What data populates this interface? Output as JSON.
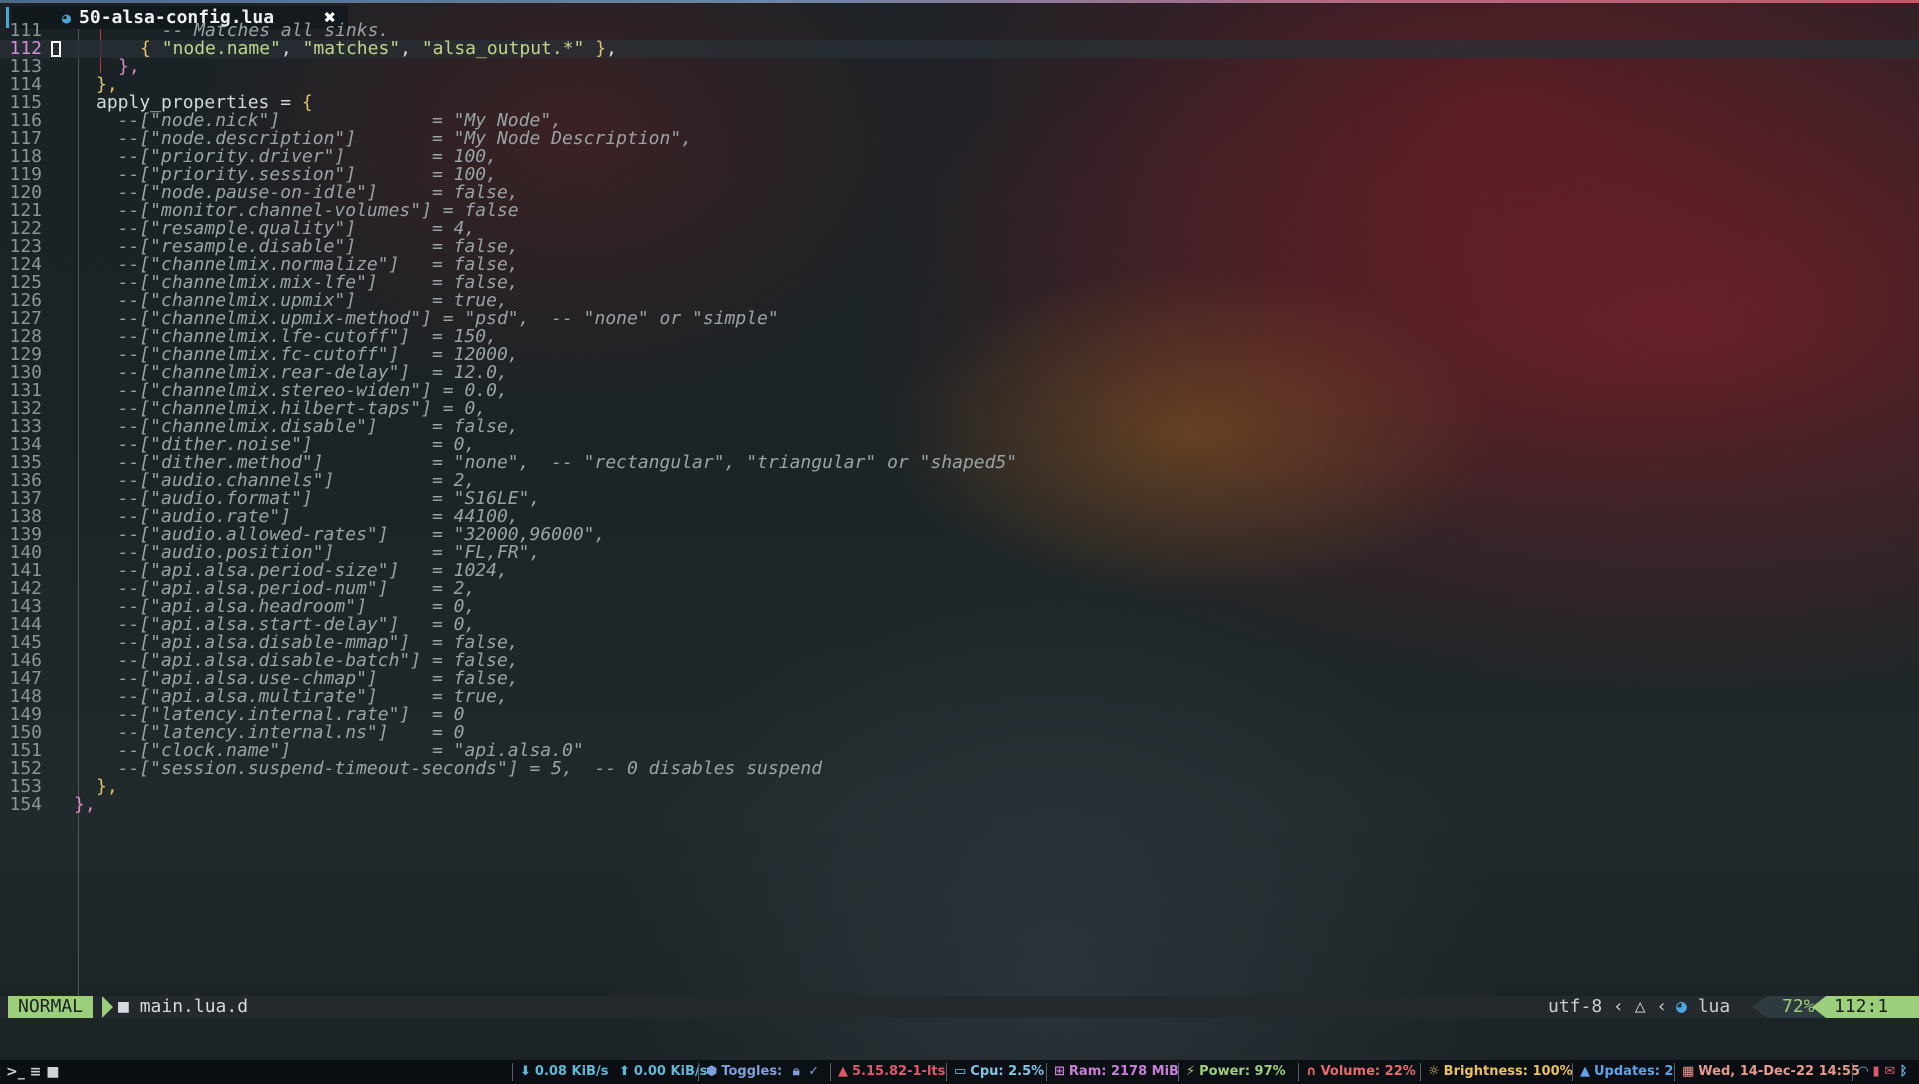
{
  "tab": {
    "filename": "50-alsa-config.lua",
    "icon": "lua-file-icon",
    "close_glyph": "✖"
  },
  "editor": {
    "lines": [
      {
        "n": "111",
        "segs": [
          [
            "com",
            "  -- Matches all sinks."
          ]
        ]
      },
      {
        "n": "112",
        "segs": [
          [
            "br",
            "{ "
          ],
          [
            "str",
            "\"node.name\""
          ],
          [
            "txt",
            ", "
          ],
          [
            "str",
            "\"matches\""
          ],
          [
            "txt",
            ", "
          ],
          [
            "str",
            "\"alsa_output.*\""
          ],
          [
            "br",
            " }"
          ],
          [
            "txt",
            ","
          ]
        ]
      },
      {
        "n": "113",
        "segs": [
          [
            "br2",
            "},"
          ]
        ]
      },
      {
        "n": "114",
        "segs": [
          [
            "br",
            "},"
          ]
        ]
      },
      {
        "n": "115",
        "segs": [
          [
            "txt",
            "apply_properties = "
          ],
          [
            "br",
            "{"
          ]
        ]
      },
      {
        "n": "116",
        "segs": [
          [
            "com",
            "  --[\"node.nick\"]              = \"My Node\","
          ]
        ]
      },
      {
        "n": "117",
        "segs": [
          [
            "com",
            "  --[\"node.description\"]       = \"My Node Description\","
          ]
        ]
      },
      {
        "n": "118",
        "segs": [
          [
            "com",
            "  --[\"priority.driver\"]        = 100,"
          ]
        ]
      },
      {
        "n": "119",
        "segs": [
          [
            "com",
            "  --[\"priority.session\"]       = 100,"
          ]
        ]
      },
      {
        "n": "120",
        "segs": [
          [
            "com",
            "  --[\"node.pause-on-idle\"]     = false,"
          ]
        ]
      },
      {
        "n": "121",
        "segs": [
          [
            "com",
            "  --[\"monitor.channel-volumes\"] = false"
          ]
        ]
      },
      {
        "n": "122",
        "segs": [
          [
            "com",
            "  --[\"resample.quality\"]       = 4,"
          ]
        ]
      },
      {
        "n": "123",
        "segs": [
          [
            "com",
            "  --[\"resample.disable\"]       = false,"
          ]
        ]
      },
      {
        "n": "124",
        "segs": [
          [
            "com",
            "  --[\"channelmix.normalize\"]   = false,"
          ]
        ]
      },
      {
        "n": "125",
        "segs": [
          [
            "com",
            "  --[\"channelmix.mix-lfe\"]     = false,"
          ]
        ]
      },
      {
        "n": "126",
        "segs": [
          [
            "com",
            "  --[\"channelmix.upmix\"]       = true,"
          ]
        ]
      },
      {
        "n": "127",
        "segs": [
          [
            "com",
            "  --[\"channelmix.upmix-method\"] = \"psd\",  -- \"none\" or \"simple\""
          ]
        ]
      },
      {
        "n": "128",
        "segs": [
          [
            "com",
            "  --[\"channelmix.lfe-cutoff\"]  = 150,"
          ]
        ]
      },
      {
        "n": "129",
        "segs": [
          [
            "com",
            "  --[\"channelmix.fc-cutoff\"]   = 12000,"
          ]
        ]
      },
      {
        "n": "130",
        "segs": [
          [
            "com",
            "  --[\"channelmix.rear-delay\"]  = 12.0,"
          ]
        ]
      },
      {
        "n": "131",
        "segs": [
          [
            "com",
            "  --[\"channelmix.stereo-widen\"] = 0.0,"
          ]
        ]
      },
      {
        "n": "132",
        "segs": [
          [
            "com",
            "  --[\"channelmix.hilbert-taps\"] = 0,"
          ]
        ]
      },
      {
        "n": "133",
        "segs": [
          [
            "com",
            "  --[\"channelmix.disable\"]     = false,"
          ]
        ]
      },
      {
        "n": "134",
        "segs": [
          [
            "com",
            "  --[\"dither.noise\"]           = 0,"
          ]
        ]
      },
      {
        "n": "135",
        "segs": [
          [
            "com",
            "  --[\"dither.method\"]          = \"none\",  -- \"rectangular\", \"triangular\" or \"shaped5\""
          ]
        ]
      },
      {
        "n": "136",
        "segs": [
          [
            "com",
            "  --[\"audio.channels\"]         = 2,"
          ]
        ]
      },
      {
        "n": "137",
        "segs": [
          [
            "com",
            "  --[\"audio.format\"]           = \"S16LE\","
          ]
        ]
      },
      {
        "n": "138",
        "segs": [
          [
            "com",
            "  --[\"audio.rate\"]             = 44100,"
          ]
        ]
      },
      {
        "n": "139",
        "segs": [
          [
            "com",
            "  --[\"audio.allowed-rates\"]    = \"32000,96000\","
          ]
        ]
      },
      {
        "n": "140",
        "segs": [
          [
            "com",
            "  --[\"audio.position\"]         = \"FL,FR\","
          ]
        ]
      },
      {
        "n": "141",
        "segs": [
          [
            "com",
            "  --[\"api.alsa.period-size\"]   = 1024,"
          ]
        ]
      },
      {
        "n": "142",
        "segs": [
          [
            "com",
            "  --[\"api.alsa.period-num\"]    = 2,"
          ]
        ]
      },
      {
        "n": "143",
        "segs": [
          [
            "com",
            "  --[\"api.alsa.headroom\"]      = 0,"
          ]
        ]
      },
      {
        "n": "144",
        "segs": [
          [
            "com",
            "  --[\"api.alsa.start-delay\"]   = 0,"
          ]
        ]
      },
      {
        "n": "145",
        "segs": [
          [
            "com",
            "  --[\"api.alsa.disable-mmap\"]  = false,"
          ]
        ]
      },
      {
        "n": "146",
        "segs": [
          [
            "com",
            "  --[\"api.alsa.disable-batch\"] = false,"
          ]
        ]
      },
      {
        "n": "147",
        "segs": [
          [
            "com",
            "  --[\"api.alsa.use-chmap\"]     = false,"
          ]
        ]
      },
      {
        "n": "148",
        "segs": [
          [
            "com",
            "  --[\"api.alsa.multirate\"]     = true,"
          ]
        ]
      },
      {
        "n": "149",
        "segs": [
          [
            "com",
            "  --[\"latency.internal.rate\"]  = 0"
          ]
        ]
      },
      {
        "n": "150",
        "segs": [
          [
            "com",
            "  --[\"latency.internal.ns\"]    = 0"
          ]
        ]
      },
      {
        "n": "151",
        "segs": [
          [
            "com",
            "  --[\"clock.name\"]             = \"api.alsa.0\""
          ]
        ]
      },
      {
        "n": "152",
        "segs": [
          [
            "com",
            "  --[\"session.suspend-timeout-seconds\"] = 5,  -- 0 disables suspend"
          ]
        ]
      },
      {
        "n": "153",
        "segs": [
          [
            "br",
            "},"
          ]
        ]
      },
      {
        "n": "154",
        "segs": [
          [
            "br2",
            "},"
          ]
        ]
      }
    ],
    "current_line": "112"
  },
  "statusline": {
    "mode": "NORMAL",
    "folder": "main.lua.d",
    "folder_icon": "folder-icon",
    "encoding": "utf-8",
    "os_icon": "linux-icon",
    "filetype": "lua",
    "percent": "72%",
    "position": "112:1"
  },
  "bar": {
    "net_down": "0.08 KiB/s",
    "net_up": "0.00 KiB/s",
    "toggles": "Toggles:",
    "kernel": "5.15.82-1-lts",
    "cpu": "Cpu: 2.5%",
    "ram": "Ram: 2178 MiB",
    "power": "Power: 97%",
    "volume": "Volume: 22%",
    "brightness": "Brightness: 100%",
    "updates": "Updates: 2",
    "clock": "Wed, 14-Dec-22  14:55",
    "colors": {
      "net": "#5fb8d6",
      "toggles": "#7f9fdc",
      "kernel": "#e0576a",
      "cpu": "#7ec6e6",
      "ram": "#c77fd8",
      "power": "#9ccf7c",
      "volume": "#e86a6a",
      "brightness": "#e8c25a",
      "updates": "#5fa3e8",
      "clock": "#e89a8a"
    }
  }
}
